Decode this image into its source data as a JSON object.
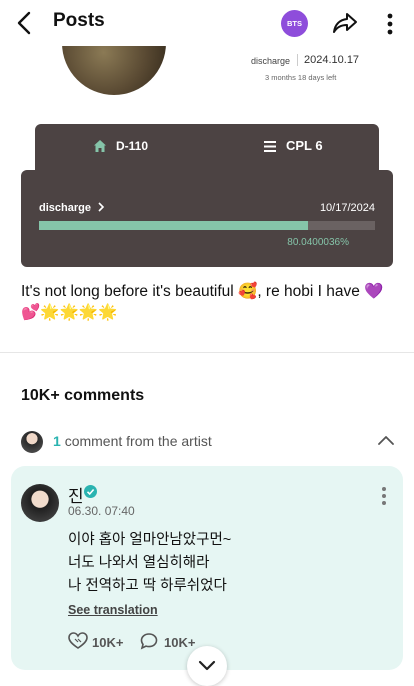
{
  "header": {
    "title": "Posts",
    "badge": "BTS",
    "back_icon": "back-arrow-icon",
    "share_icon": "share-icon",
    "more_icon": "more-vertical-icon"
  },
  "discharge_info": {
    "label": "discharge",
    "date": "2024.10.17",
    "remaining": "3 months 18 days left"
  },
  "card": {
    "dday_label": "D-110",
    "rank_label": "CPL 6",
    "discharge_link": "discharge",
    "end_date": "10/17/2024",
    "progress_percent_text": "80.0400036%",
    "progress_fraction": 0.8,
    "accent_color": "#85c4a9",
    "card_color": "#4c4343"
  },
  "post": {
    "text": "It's not long before it's beautiful 🥰, re hobi I have 💜 💕🌟🌟🌟🌟"
  },
  "comments": {
    "title": "10K+ comments",
    "artist_count": "1",
    "artist_text": "comment from the artist",
    "comment": {
      "author": "진",
      "date": "06.30. 07:40",
      "lines": [
        "이야 홉아 얼마안남았구먼~",
        "너도 나와서 열심히해라",
        "나 전역하고 딱 하루쉬었다"
      ],
      "see_translation": "See translation",
      "likes": "10K+",
      "replies": "10K+"
    }
  }
}
